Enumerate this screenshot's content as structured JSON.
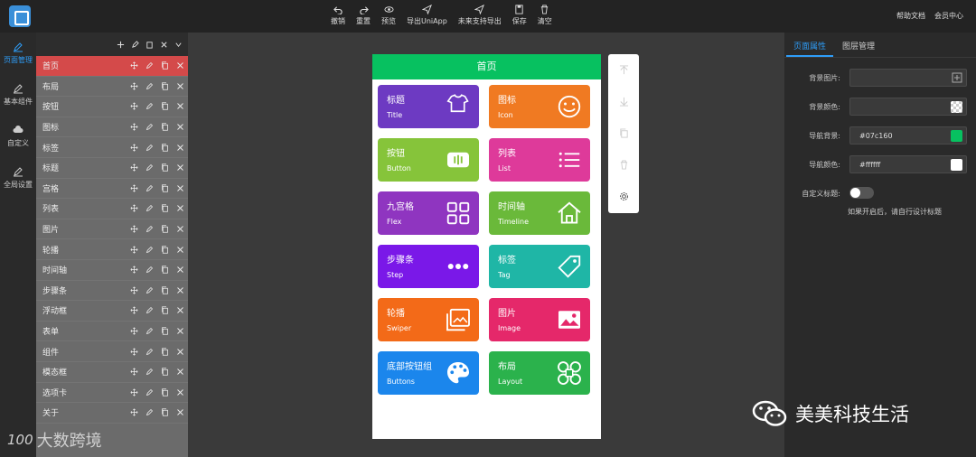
{
  "toolbar": {
    "items": [
      {
        "label": "撤销",
        "icon": "undo-icon"
      },
      {
        "label": "重置",
        "icon": "redo-icon"
      },
      {
        "label": "预览",
        "icon": "eye-icon"
      },
      {
        "label": "导出UniApp",
        "icon": "send-icon"
      },
      {
        "label": "未来支持导出",
        "icon": "send-icon"
      },
      {
        "label": "保存",
        "icon": "save-icon"
      },
      {
        "label": "清空",
        "icon": "trash-icon"
      }
    ],
    "links": [
      "帮助文档",
      "会员中心"
    ]
  },
  "iconbar": [
    {
      "label": "页面管理",
      "icon": "pencil-icon",
      "active": true
    },
    {
      "label": "基本组件",
      "icon": "pencil-icon",
      "active": false
    },
    {
      "label": "自定义",
      "icon": "cloud-upload-icon",
      "active": false
    },
    {
      "label": "全局设置",
      "icon": "pencil-icon",
      "active": false
    }
  ],
  "pagelist": {
    "items": [
      "首页",
      "布局",
      "按钮",
      "图标",
      "标签",
      "标题",
      "宫格",
      "列表",
      "图片",
      "轮播",
      "时间轴",
      "步骤条",
      "浮动框",
      "表单",
      "组件",
      "模态框",
      "选项卡",
      "关于"
    ],
    "active_index": 0
  },
  "phone": {
    "title": "首页",
    "header_color": "#07c160",
    "cards": [
      {
        "title": "标题",
        "sub": "Title",
        "icon": "tshirt-icon",
        "color": "#6d3ac2"
      },
      {
        "title": "图标",
        "sub": "Icon",
        "icon": "smile-icon",
        "color": "#f07a22"
      },
      {
        "title": "按钮",
        "sub": "Button",
        "icon": "button-icon",
        "color": "#86c43a"
      },
      {
        "title": "列表",
        "sub": "List",
        "icon": "list-icon",
        "color": "#de3a9a"
      },
      {
        "title": "九宫格",
        "sub": "Flex",
        "icon": "grid-icon",
        "color": "#8f35c0"
      },
      {
        "title": "时间轴",
        "sub": "Timeline",
        "icon": "home-icon",
        "color": "#6ab93a"
      },
      {
        "title": "步骤条",
        "sub": "Step",
        "icon": "dots-icon",
        "color": "#7a18e8"
      },
      {
        "title": "标签",
        "sub": "Tag",
        "icon": "tag-icon",
        "color": "#1fb6a6"
      },
      {
        "title": "轮播",
        "sub": "Swiper",
        "icon": "swiper-icon",
        "color": "#f36a18"
      },
      {
        "title": "图片",
        "sub": "Image",
        "icon": "image-icon",
        "color": "#e5286a"
      },
      {
        "title": "底部按钮组",
        "sub": "Buttons",
        "icon": "palette-icon",
        "color": "#1b86ec"
      },
      {
        "title": "布局",
        "sub": "Layout",
        "icon": "layout-icon",
        "color": "#2bb24c"
      }
    ]
  },
  "floatbar": [
    "arrow-up-icon",
    "arrow-down-icon",
    "copy-icon",
    "trash-icon",
    "gear-icon"
  ],
  "rightpanel": {
    "tabs": [
      "页面属性",
      "图层管理"
    ],
    "props": [
      {
        "label": "背景图片:",
        "value": "",
        "icon": "plus-icon"
      },
      {
        "label": "背景颜色:",
        "value": "",
        "swatch": "checker"
      },
      {
        "label": "导航背景:",
        "value": "#07c160",
        "swatch": "#07c160"
      },
      {
        "label": "导航颜色:",
        "value": "#ffffff",
        "swatch": "#ffffff"
      }
    ],
    "custom_title_label": "自定义标题:",
    "hint": "如果开启后，请自行设计标题"
  },
  "watermark": {
    "wechat": "美美科技生活",
    "logo_text": "大数跨境",
    "logo_mark": "100"
  }
}
